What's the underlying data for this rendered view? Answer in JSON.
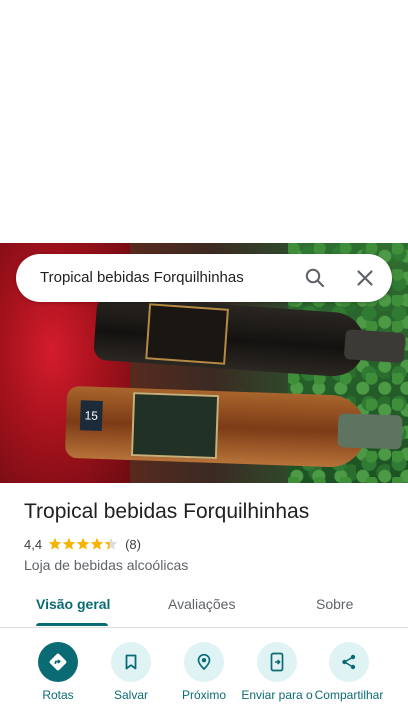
{
  "search": {
    "query": "Tropical bebidas Forquilhinhas"
  },
  "place": {
    "title": "Tropical bebidas Forquilhinhas",
    "rating": "4,4",
    "rating_value": 4.4,
    "review_count": "(8)",
    "category": "Loja de bebidas alcoólicas"
  },
  "tabs": [
    {
      "label": "Visão geral",
      "active": true
    },
    {
      "label": "Avaliações",
      "active": false
    },
    {
      "label": "Sobre",
      "active": false
    }
  ],
  "actions": [
    {
      "label": "Rotas",
      "icon": "directions-icon"
    },
    {
      "label": "Salvar",
      "icon": "bookmark-icon"
    },
    {
      "label": "Próximo",
      "icon": "nearby-icon"
    },
    {
      "label": "Enviar para o",
      "icon": "send-to-phone-icon"
    },
    {
      "label": "Compartilhar",
      "icon": "share-icon"
    }
  ],
  "colors": {
    "accent": "#0b6b74",
    "accent_light": "#dff3f5",
    "star": "#f4b400",
    "text_primary": "#202124",
    "text_secondary": "#5f6368"
  }
}
